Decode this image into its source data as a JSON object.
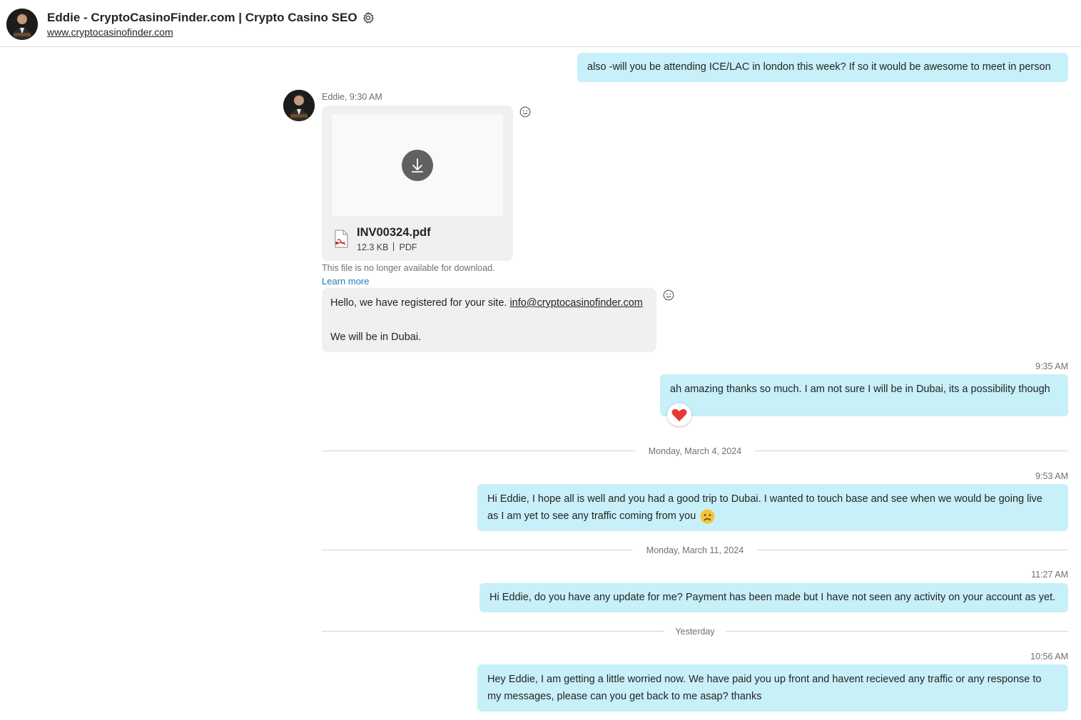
{
  "header": {
    "title": "Eddie - CryptoCasinoFinder.com | Crypto Casino SEO",
    "url": "www.cryptocasinofinder.com"
  },
  "messages": {
    "m1_text": "also -will you be attending ICE/LAC in london this week? If so it would be awesome to meet in person",
    "eddie_meta": "Eddie, 9:30 AM",
    "file": {
      "name": "INV00324.pdf",
      "size": "12.3 KB",
      "type": "PDF",
      "unavailable": "This file is no longer available for download.",
      "learn_more": "Learn more"
    },
    "in2_text_a": "Hello, we have registered for your site. ",
    "in2_email": "info@cryptocasinofinder.com",
    "in2_text_b": "We will be in Dubai.",
    "m3_time": "9:35 AM",
    "m3_text": "ah amazing thanks so much.  I am not sure I will be in Dubai, its a possibility though",
    "m3_reaction": "heart",
    "divider1": "Monday, March 4, 2024",
    "m4_time": "9:53 AM",
    "m4_line1": "Hi Eddie, I hope all is well and you had a good trip to Dubai. I wanted to touch base and see when we would be going live",
    "m4_line2": "as I am yet to see any traffic coming from you",
    "divider2": "Monday, March 11, 2024",
    "m5_time": "11:27 AM",
    "m5_text": "Hi Eddie, do you have any update for me? Payment has been made but I have not seen any activity on your account as yet.",
    "divider3": "Yesterday",
    "m6_time": "10:56 AM",
    "m6_line1": "Hey Eddie, I am getting a little worried now. We have paid you up front and havent recieved any traffic or any response to",
    "m6_line2": "my messages, please can you get back to me asap? thanks"
  },
  "colors": {
    "outgoing_bubble": "#c7f0f9",
    "incoming_bubble": "#f0f0f0",
    "link_blue": "#1f7ab8",
    "heart_red": "#e53935"
  },
  "icons": [
    "settings-gear-icon",
    "download-icon",
    "pdf-file-icon",
    "emoji-smile-icon",
    "heart-reaction-icon",
    "sad-face-emoji-icon"
  ]
}
